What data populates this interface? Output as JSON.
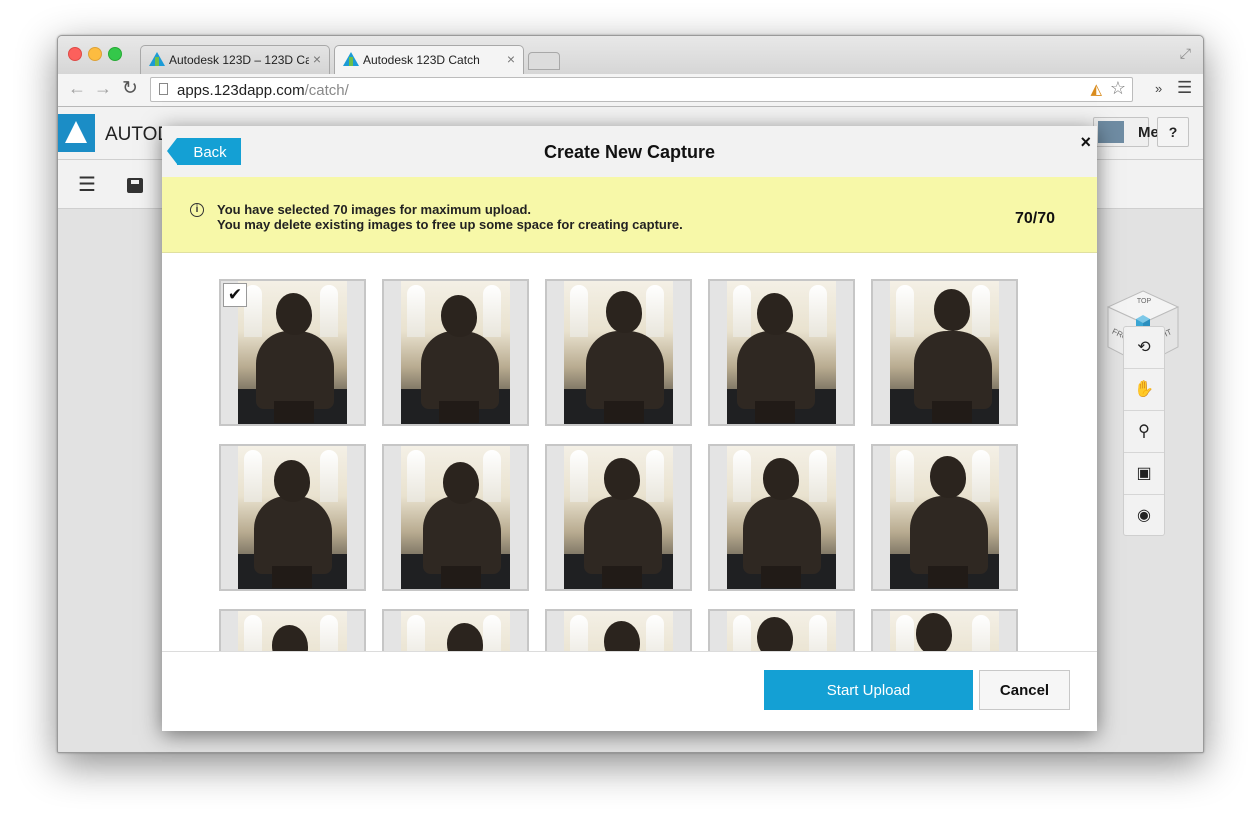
{
  "browser": {
    "tabs": [
      {
        "label": "Autodesk 123D – 123D Ca",
        "close": "×"
      },
      {
        "label": "Autodesk 123D Catch",
        "close": "×"
      }
    ],
    "url_host": "apps.123dapp.com",
    "url_path": "/catch/"
  },
  "app": {
    "brand_name": "AUTODESK",
    "user_label": "Me",
    "help_label": "?",
    "viewcube": {
      "top": "TOP",
      "front": "FRONT",
      "right": "RIGHT"
    },
    "tools": [
      "orbit-icon",
      "pan-icon",
      "zoom-icon",
      "fit-icon",
      "eye-icon"
    ]
  },
  "modal": {
    "back_label": "Back",
    "title": "Create New Capture",
    "close": "×",
    "notice_line1": "You have selected 70 images for maximum upload.",
    "notice_line2": "You may delete existing images to free up some space for creating capture.",
    "counter": "70/70",
    "selected_index": 0,
    "start_label": "Start Upload",
    "cancel_label": "Cancel"
  },
  "colors": {
    "accent": "#14a0d4",
    "notice_bg": "#f7f8a8",
    "brand": "#1b8dc6"
  }
}
